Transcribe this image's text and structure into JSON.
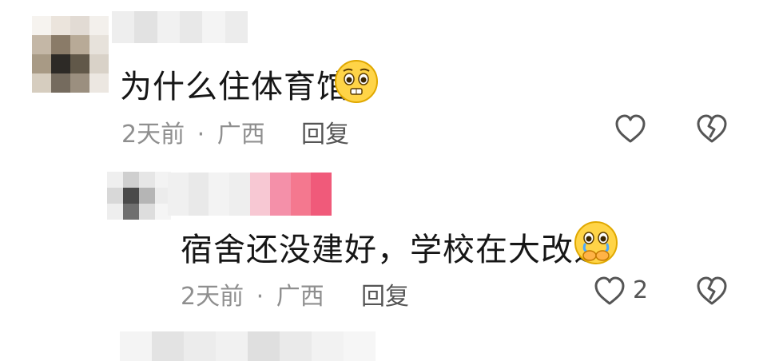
{
  "comments": [
    {
      "text": "为什么住体育馆",
      "time": "2天前",
      "separator": "·",
      "location": "广西",
      "reply_label": "回复",
      "emoji": "pleading-face",
      "like_count": ""
    },
    {
      "text": "宿舍还没建好，学校在大改造",
      "time": "2天前",
      "separator": "·",
      "location": "广西",
      "reply_label": "回复",
      "emoji": "crying-face-hands-over-mouth",
      "like_count": "2"
    }
  ],
  "icons": {
    "like": "heart-outline-icon",
    "dislike": "broken-heart-icon"
  },
  "colors": {
    "text_main": "#161616",
    "text_meta": "#8f8f8f",
    "icon_stroke": "#555555",
    "username_pink": "#f06a8b"
  }
}
